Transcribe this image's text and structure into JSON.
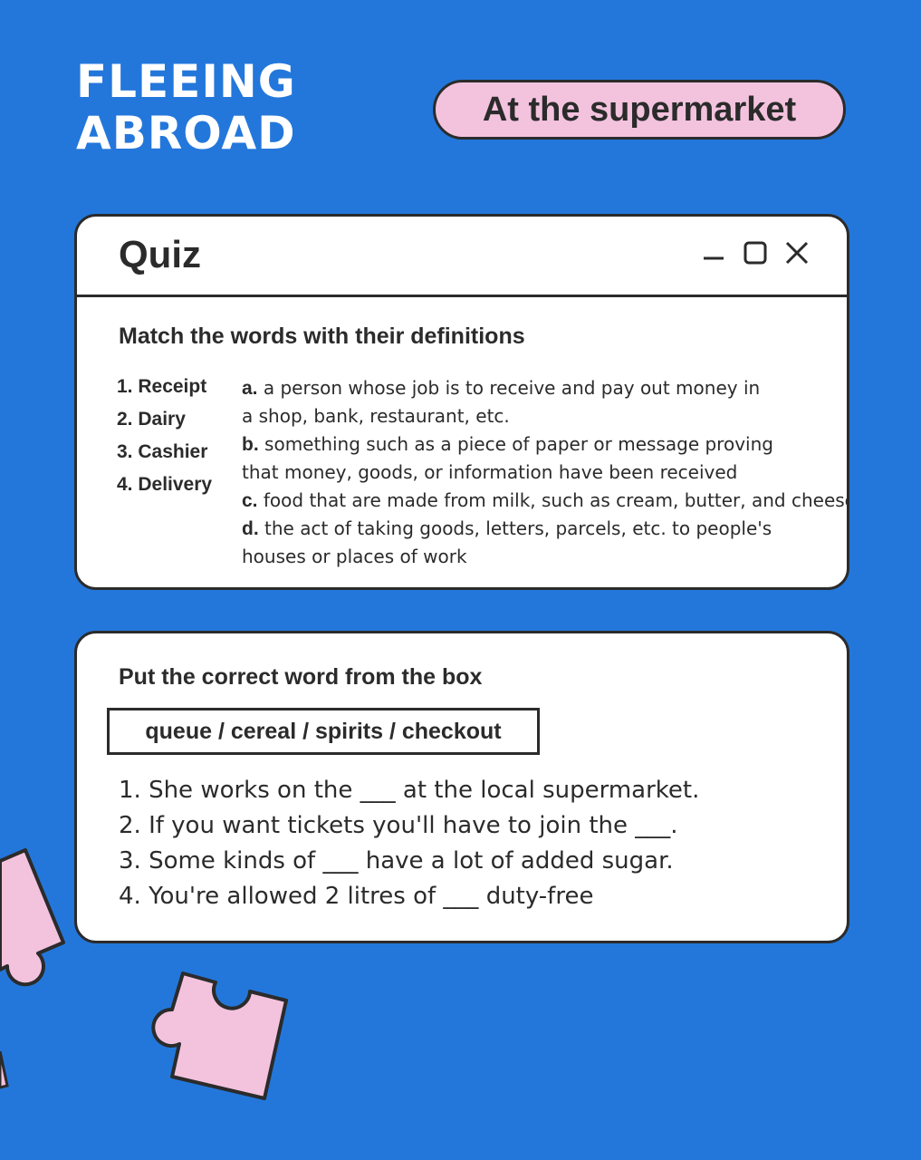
{
  "header": {
    "brand_line1": "FLEEING",
    "brand_line2": "ABROAD",
    "topic": "At the supermarket"
  },
  "quiz_window": {
    "title": "Quiz",
    "controls": [
      "minimize-icon",
      "maximize-icon",
      "close-icon"
    ]
  },
  "match_section": {
    "heading": "Match the words with their definitions",
    "words": [
      "1. Receipt",
      "2. Dairy",
      "3. Cashier",
      "4. Delivery"
    ],
    "definitions": [
      {
        "letter": "a.",
        "line1": "a person whose job is to receive and pay out money in",
        "line2": "a shop, bank, restaurant, etc."
      },
      {
        "letter": "b.",
        "line1": "something such as a piece of paper or message proving",
        "line2": "that money, goods, or information have been received"
      },
      {
        "letter": "c.",
        "line1": "food that are made from milk, such as cream, butter, and cheese",
        "line2": ""
      },
      {
        "letter": "d.",
        "line1": "the act of taking goods, letters, parcels, etc. to people's",
        "line2": "houses or places of work"
      }
    ]
  },
  "fill_section": {
    "heading": "Put the correct word from the box",
    "word_box": "queue / cereal / spirits / checkout",
    "sentences": [
      "1. She works on the ___ at the local supermarket.",
      "2. If you want tickets you'll have to join the ___.",
      "3. Some kinds of ___ have a lot of added sugar.",
      "4. You're allowed 2 litres of ___ duty-free"
    ]
  },
  "colors": {
    "background": "#2377db",
    "pill": "#f3c3de",
    "ink": "#2b2b2b",
    "card": "#ffffff",
    "puzzle": "#f3c3de"
  }
}
